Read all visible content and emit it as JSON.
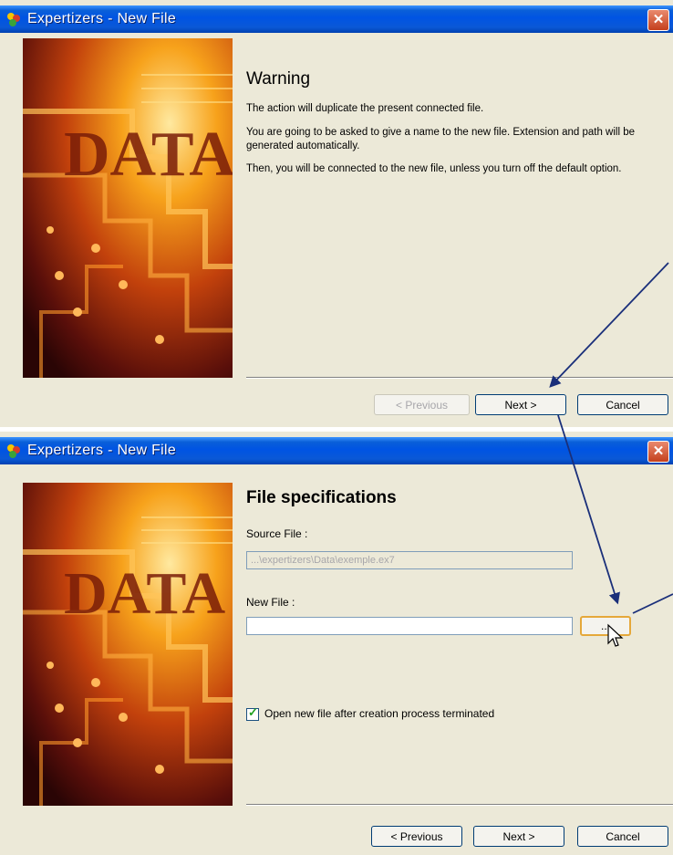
{
  "dialogs": [
    {
      "title": "Expertizers - New File",
      "heading": "Warning",
      "paragraphs": [
        "The action will duplicate the present connected file.",
        "You are going to be asked to give a name to the new file. Extension and path will be generated automatically.",
        "Then, you will be connected to the new file, unless you turn off the default option."
      ],
      "buttons": {
        "previous": "< Previous",
        "next": "Next >",
        "cancel": "Cancel"
      },
      "previous_enabled": false
    },
    {
      "title": "Expertizers - New File",
      "heading": "File specifications",
      "source_label": "Source File :",
      "source_value": "...\\expertizers\\Data\\exemple.ex7",
      "newfile_label": "New File :",
      "newfile_value": "",
      "browse_label": "...",
      "checkbox_label": "Open new file after creation process terminated",
      "checkbox_checked": true,
      "buttons": {
        "previous": "< Previous",
        "next": "Next >",
        "cancel": "Cancel"
      }
    }
  ],
  "art_text": "DATA",
  "icons": {
    "app": "app-icon",
    "close": "close-icon",
    "cursor": "mouse-pointer-icon"
  },
  "colors": {
    "dialog_bg": "#ece9d8",
    "titlebar": "#0054e3",
    "arrow": "#1a2f7a"
  }
}
